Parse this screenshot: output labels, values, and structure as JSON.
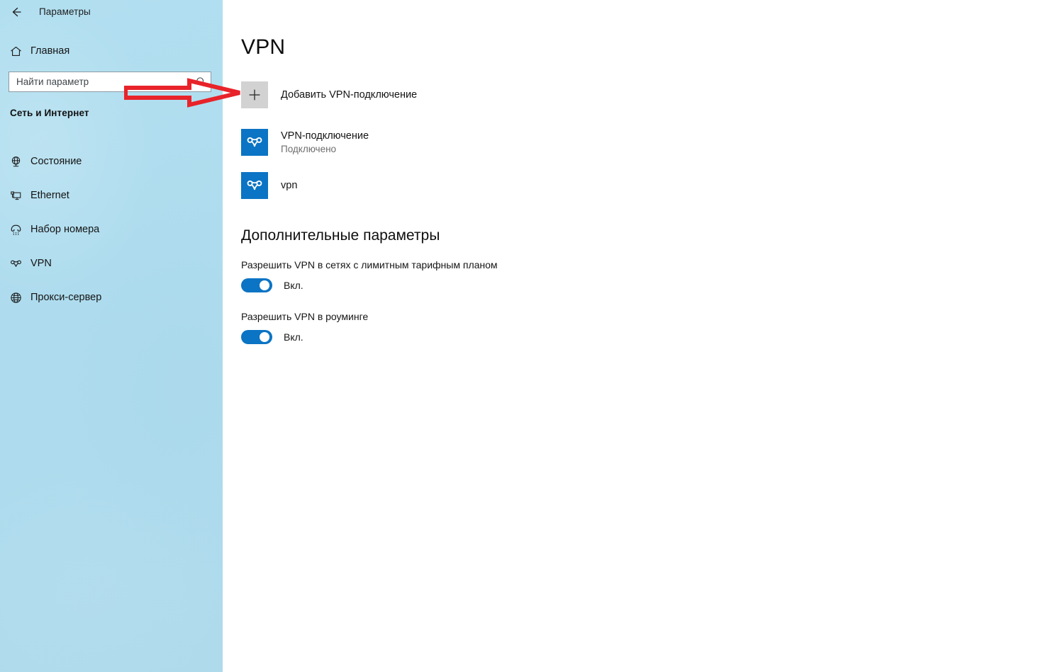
{
  "window": {
    "title": "Параметры",
    "back_icon": "back-arrow-icon"
  },
  "sidebar": {
    "home": {
      "label": "Главная",
      "icon": "home-icon"
    },
    "search": {
      "placeholder": "Найти параметр",
      "value": "",
      "icon": "search-icon"
    },
    "section_label": "Сеть и Интернет",
    "items": [
      {
        "label": "Состояние",
        "icon": "network-status-icon",
        "selected": false
      },
      {
        "label": "Ethernet",
        "icon": "ethernet-icon",
        "selected": false
      },
      {
        "label": "Набор номера",
        "icon": "dial-up-phone-icon",
        "selected": false
      },
      {
        "label": "VPN",
        "icon": "vpn-knot-icon",
        "selected": true
      },
      {
        "label": "Прокси-сервер",
        "icon": "globe-proxy-icon",
        "selected": false
      }
    ]
  },
  "main": {
    "page_title": "VPN",
    "add_connection": {
      "label": "Добавить VPN-подключение",
      "icon": "plus-icon"
    },
    "connections": [
      {
        "name": "VPN-подключение",
        "status": "Подключено",
        "icon": "vpn-knot-icon"
      },
      {
        "name": "vpn",
        "status": "",
        "icon": "vpn-knot-icon"
      }
    ],
    "advanced": {
      "heading": "Дополнительные параметры",
      "settings": [
        {
          "label": "Разрешить VPN в сетях с лимитным тарифным планом",
          "value": "Вкл.",
          "on": true
        },
        {
          "label": "Разрешить VPN в роуминге",
          "value": "Вкл.",
          "on": true
        }
      ]
    }
  },
  "annotation": {
    "type": "arrow",
    "direction": "right",
    "color": "#e8232a",
    "target": "Добавить VPN-подключение"
  },
  "colors": {
    "sidebar_background": "#aeddef",
    "accent": "#0b74c4",
    "main_background": "#ffffff",
    "annotation_red": "#e8232a",
    "add_tile_gray": "#d2d2d2",
    "status_text": "#6d6d6d"
  }
}
